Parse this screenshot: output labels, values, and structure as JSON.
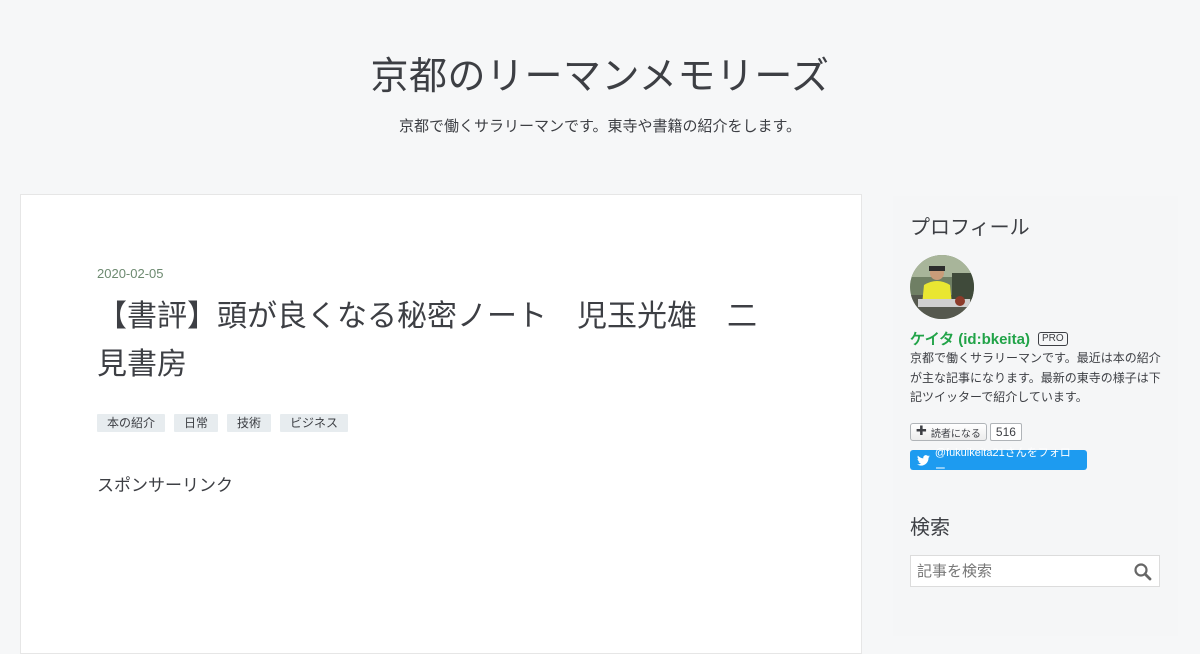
{
  "header": {
    "title": "京都のリーマンメモリーズ",
    "description": "京都で働くサラリーマンです。東寺や書籍の紹介をします。"
  },
  "article": {
    "date": "2020-02-05",
    "title": "【書評】頭が良くなる秘密ノート　児玉光雄　二見書房",
    "categories": [
      "本の紹介",
      "日常",
      "技術",
      "ビジネス"
    ],
    "sponsor_label": "スポンサーリンク"
  },
  "sidebar": {
    "profile": {
      "title": "プロフィール",
      "name": "ケイタ (id:bkeita)",
      "badge": "PRO",
      "description": "京都で働くサラリーマンです。最近は本の紹介が主な記事になります。最新の東寺の様子は下記ツイッターで紹介しています。",
      "reader_button": "読者になる",
      "reader_count": "516",
      "twitter_follow": "@fukuikeita21さんをフォロー",
      "twitter_color": "#1d9bf0",
      "name_color": "#21a348"
    },
    "search": {
      "title": "検索",
      "placeholder": "記事を検索"
    }
  },
  "icons": {
    "plus": "plus-icon",
    "twitter": "twitter-bird-icon",
    "search": "magnifier-icon",
    "avatar": "profile-photo"
  }
}
